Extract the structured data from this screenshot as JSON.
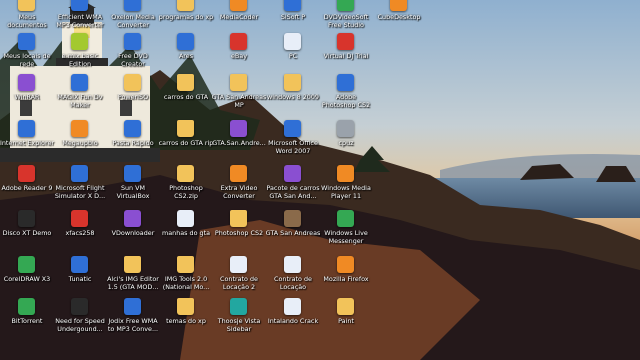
{
  "palette": {
    "folder": "#f2c35a",
    "doc": "#e8eef8",
    "orange": "#f08a24",
    "red": "#d8342c",
    "green": "#34a853",
    "blue": "#2f6fd6",
    "purple": "#8a4fd1",
    "teal": "#22a7a0",
    "gray": "#9aa2ab"
  },
  "desktop_icons": [
    {
      "label": "Meus\ndocumentos",
      "icon": "folder-icon",
      "color": "#f2c35a"
    },
    {
      "label": "Efficient WMA\nMP3 Converter",
      "icon": "app-icon",
      "color": "#2f6fd6"
    },
    {
      "label": "Oxelon Media\nConverter",
      "icon": "app-icon",
      "color": "#2f6fd6"
    },
    {
      "label": "programas do xp",
      "icon": "folder-icon",
      "color": "#f2c35a"
    },
    {
      "label": "MediaCoder",
      "icon": "app-icon",
      "color": "#f08a24"
    },
    {
      "label": "SiSoft P",
      "icon": "app-icon",
      "color": "#2f6fd6"
    },
    {
      "label": "DVDVideoSoft\nFree Studio",
      "icon": "app-icon",
      "color": "#34a853"
    },
    {
      "label": "CubeDesktop",
      "icon": "app-icon",
      "color": "#f08a24"
    },
    {
      "label": "Meus locais de\nrede",
      "icon": "network-icon",
      "color": "#2f6fd6"
    },
    {
      "label": "e-mix basic\nEdition",
      "icon": "app-icon",
      "color": "#a3c92f"
    },
    {
      "label": "Free DVD\nCreator",
      "icon": "disc-icon",
      "color": "#2f6fd6"
    },
    {
      "label": "Ares",
      "icon": "app-icon",
      "color": "#2f6fd6"
    },
    {
      "label": "eBay",
      "icon": "app-icon",
      "color": "#d8342c"
    },
    {
      "label": "PC",
      "icon": "document-icon",
      "color": "#e8eef8"
    },
    {
      "label": "Virtual DJ Trial",
      "icon": "app-icon",
      "color": "#d8342c"
    },
    {
      "label": "WinRAR",
      "icon": "archive-icon",
      "color": "#8a4fd1"
    },
    {
      "label": "MAGIX Fun Dv\nMaker",
      "icon": "app-icon",
      "color": "#2f6fd6"
    },
    {
      "label": "PowerISO",
      "icon": "disc-icon",
      "color": "#f2c35a"
    },
    {
      "label": "carros do GTA",
      "icon": "folder-icon",
      "color": "#f2c35a"
    },
    {
      "label": "GTA San Andreas\nMP",
      "icon": "folder-icon",
      "color": "#f2c35a"
    },
    {
      "label": "windows 8 2009",
      "icon": "folder-icon",
      "color": "#f2c35a"
    },
    {
      "label": "Adobe\nPhotoshop CS2",
      "icon": "app-icon",
      "color": "#2f6fd6"
    },
    {
      "label": "Internet Explorer",
      "icon": "browser-icon",
      "color": "#2f6fd6"
    },
    {
      "label": "Megaupbio",
      "icon": "app-icon",
      "color": "#f08a24"
    },
    {
      "label": "Pasta Rápido",
      "icon": "app-icon",
      "color": "#2f6fd6"
    },
    {
      "label": "carros do GTA rip",
      "icon": "folder-icon",
      "color": "#f2c35a"
    },
    {
      "label": "GTA.San.Andre...",
      "icon": "archive-icon",
      "color": "#8a4fd1"
    },
    {
      "label": "Microsoft Office\nWord 2007",
      "icon": "document-icon",
      "color": "#2f6fd6"
    },
    {
      "label": "cpuz",
      "icon": "app-icon",
      "color": "#9aa2ab"
    },
    {
      "label": "Adobe Reader 9",
      "icon": "pdf-icon",
      "color": "#d8342c"
    },
    {
      "label": "Microsoft Flight\nSimulator X D...",
      "icon": "app-icon",
      "color": "#2f6fd6"
    },
    {
      "label": "Sun VM\nVirtualBox",
      "icon": "app-icon",
      "color": "#2f6fd6"
    },
    {
      "label": "Photoshop\nCS2.zip",
      "icon": "archive-icon",
      "color": "#f2c35a"
    },
    {
      "label": "Extra Video\nConverter",
      "icon": "app-icon",
      "color": "#f08a24"
    },
    {
      "label": "Pacote de carros\nGTA San And...",
      "icon": "archive-icon",
      "color": "#8a4fd1"
    },
    {
      "label": "Windows Media\nPlayer 11",
      "icon": "app-icon",
      "color": "#f08a24"
    },
    {
      "label": "Disco XT Demo",
      "icon": "app-icon",
      "color": "#2a2a2a"
    },
    {
      "label": "xfacs258",
      "icon": "app-icon",
      "color": "#d8342c"
    },
    {
      "label": "VDownloader",
      "icon": "app-icon",
      "color": "#8a4fd1"
    },
    {
      "label": "manhas do gta",
      "icon": "document-icon",
      "color": "#e8eef8"
    },
    {
      "label": "Photoshop CS2",
      "icon": "folder-icon",
      "color": "#f2c35a"
    },
    {
      "label": "GTA San Andreas",
      "icon": "app-icon",
      "color": "#8a6a4a"
    },
    {
      "label": "Windows Live\nMessenger",
      "icon": "app-icon",
      "color": "#34a853"
    },
    {
      "label": "CorelDRAW X3",
      "icon": "app-icon",
      "color": "#34a853"
    },
    {
      "label": "Tunatic",
      "icon": "app-icon",
      "color": "#2f6fd6"
    },
    {
      "label": "Alci's IMG Editor\n1.5 (GTA MOD...",
      "icon": "folder-icon",
      "color": "#f2c35a"
    },
    {
      "label": "IMG Tools 2.0\n(National Mo...",
      "icon": "folder-icon",
      "color": "#f2c35a"
    },
    {
      "label": "Contrato de\nLocação 2",
      "icon": "document-icon",
      "color": "#e8eef8"
    },
    {
      "label": "Contrato de\nLocação",
      "icon": "document-icon",
      "color": "#e8eef8"
    },
    {
      "label": "Mozilla Firefox",
      "icon": "browser-icon",
      "color": "#f08a24"
    },
    {
      "label": "BitTorrent",
      "icon": "app-icon",
      "color": "#34a853"
    },
    {
      "label": "Need for Speed\nUndergound...",
      "icon": "app-icon",
      "color": "#2a2a2a"
    },
    {
      "label": "Jodix Free WMA\nto MP3 Conve...",
      "icon": "app-icon",
      "color": "#2f6fd6"
    },
    {
      "label": "temas do xp",
      "icon": "folder-icon",
      "color": "#f2c35a"
    },
    {
      "label": "Thoosje Vista\nSidebar",
      "icon": "app-icon",
      "color": "#22a7a0"
    },
    {
      "label": "Intalando Crack",
      "icon": "document-icon",
      "color": "#e8eef8"
    },
    {
      "label": "Paint",
      "icon": "app-icon",
      "color": "#f2c35a"
    }
  ]
}
